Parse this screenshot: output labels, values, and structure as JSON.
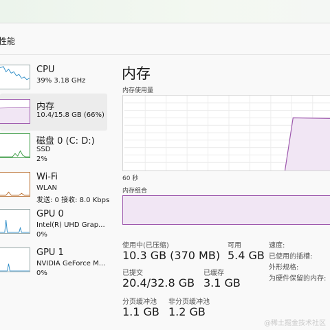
{
  "page": {
    "title": "性能"
  },
  "sidebar": {
    "items": [
      {
        "name": "CPU",
        "line2": "39%  3.18 GHz",
        "line3": ""
      },
      {
        "name": "内存",
        "line2": "10.4/15.8 GB (66%)",
        "line3": ""
      },
      {
        "name": "磁盘 0 (C: D:)",
        "line2": "SSD",
        "line3": "2%"
      },
      {
        "name": "Wi-Fi",
        "line2": "WLAN",
        "line3": "发送: 0 接收: 8.0 Kbps"
      },
      {
        "name": "GPU 0",
        "line2": "Intel(R) UHD Grap...",
        "line3": "0%"
      },
      {
        "name": "GPU 1",
        "line2": "NVIDIA GeForce M...",
        "line3": "0%"
      }
    ]
  },
  "memory": {
    "title": "内存",
    "usage_label": "内存使用量",
    "time_label": "60 秒",
    "composition_label": "内存组合",
    "usage_fraction": 0.66,
    "stats": {
      "in_use_label": "使用中(已压缩)",
      "in_use_value": "10.3 GB (370 MB)",
      "available_label": "可用",
      "available_value": "5.4 GB",
      "committed_label": "已提交",
      "committed_value": "20.4/32.8 GB",
      "cached_label": "已缓存",
      "cached_value": "3.1 GB",
      "paged_label": "分页缓冲池",
      "paged_value": "1.1 GB",
      "nonpaged_label": "非分页缓冲池",
      "nonpaged_value": "1.2 GB",
      "speed_label": "速度:",
      "slots_label": "已使用的插槽:",
      "form_label": "外形规格:",
      "reserved_label": "为硬件保留的内存:"
    }
  },
  "watermark": "@稀土掘金技术社区",
  "colors": {
    "memory": "#9d57ad",
    "cpu": "#2f8ec8",
    "disk": "#3c9b45",
    "wifi": "#b86c2c",
    "gpu": "#2f8ec8"
  }
}
